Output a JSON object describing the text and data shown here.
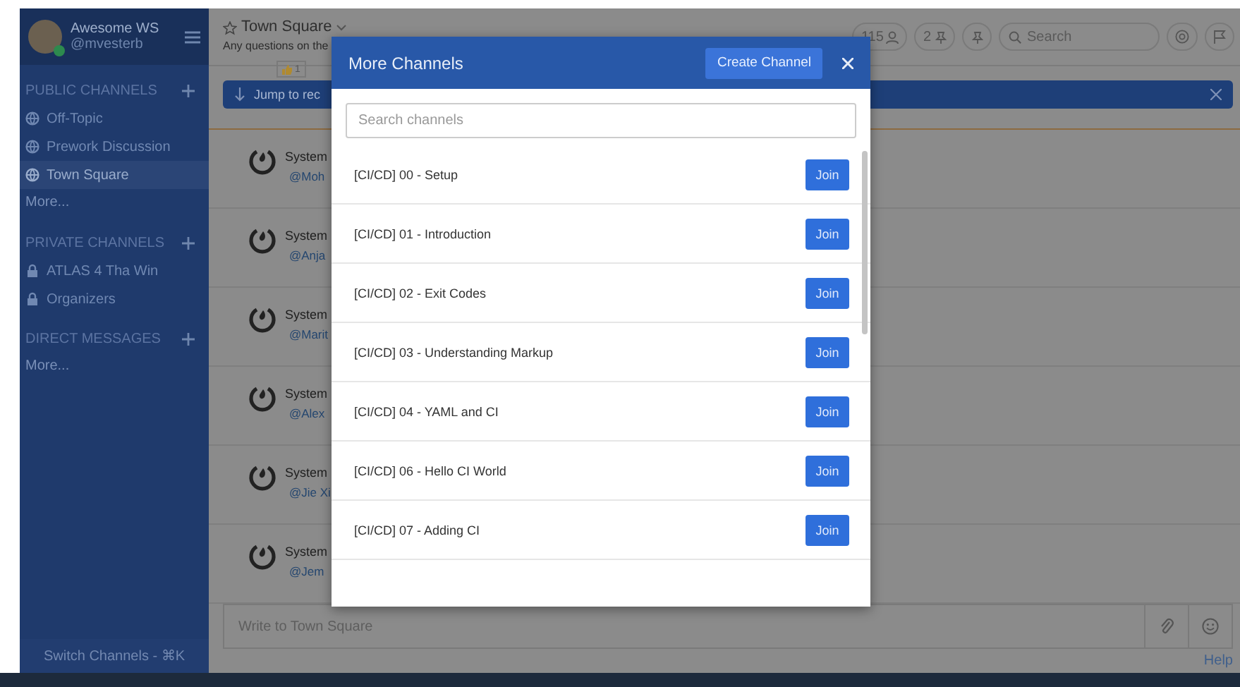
{
  "workspace": {
    "name": "Awesome WS",
    "user": "@mvesterb"
  },
  "sidebar": {
    "sections": [
      {
        "title": "PUBLIC CHANNELS",
        "items": [
          {
            "label": "Off-Topic",
            "kind": "public",
            "selected": false
          },
          {
            "label": "Prework Discussion",
            "kind": "public",
            "selected": false
          },
          {
            "label": "Town Square",
            "kind": "public",
            "selected": true
          }
        ],
        "more": "More..."
      },
      {
        "title": "PRIVATE CHANNELS",
        "items": [
          {
            "label": "ATLAS 4 Tha Win",
            "kind": "private",
            "selected": false
          },
          {
            "label": "Organizers",
            "kind": "private",
            "selected": false
          }
        ]
      },
      {
        "title": "DIRECT MESSAGES",
        "more": "More..."
      }
    ],
    "switch_channels": "Switch Channels - ⌘K"
  },
  "header": {
    "title": "Town Square",
    "purpose": "Any questions on the",
    "members": "115",
    "pinned": "2",
    "search_placeholder": "Search"
  },
  "reaction": {
    "count": "1"
  },
  "banner": {
    "text": "Jump to rec"
  },
  "messages": [
    {
      "author": "System",
      "handle": "@Moh"
    },
    {
      "author": "System",
      "handle": "@Anja"
    },
    {
      "author": "System",
      "handle": "@Marit"
    },
    {
      "author": "System",
      "handle": "@Alex"
    },
    {
      "author": "System",
      "handle": "@Jie Xi"
    },
    {
      "author": "System",
      "handle": "@Jem"
    }
  ],
  "composer": {
    "placeholder": "Write to Town Square"
  },
  "help": "Help",
  "modal": {
    "title": "More Channels",
    "create_button": "Create Channel",
    "search_placeholder": "Search channels",
    "channels": [
      {
        "name": "[CI/CD] 00 - Setup",
        "button": "Join"
      },
      {
        "name": "[CI/CD] 01 - Introduction",
        "button": "Join"
      },
      {
        "name": "[CI/CD] 02 - Exit Codes",
        "button": "Join"
      },
      {
        "name": "[CI/CD] 03 - Understanding Markup",
        "button": "Join"
      },
      {
        "name": "[CI/CD] 04 - YAML and CI",
        "button": "Join"
      },
      {
        "name": "[CI/CD] 06 - Hello CI World",
        "button": "Join"
      },
      {
        "name": "[CI/CD] 07 - Adding CI",
        "button": "Join"
      }
    ]
  }
}
